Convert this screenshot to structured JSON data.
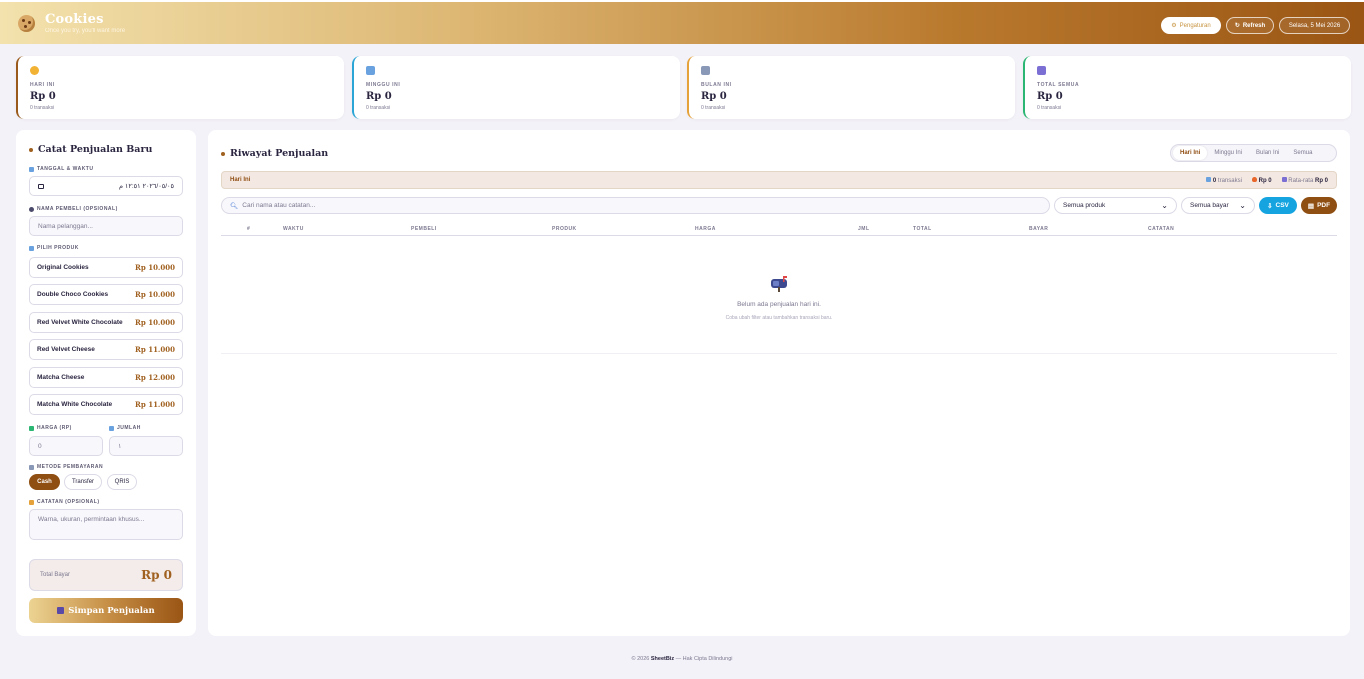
{
  "header": {
    "brand": "Cookies",
    "tagline": "Once you try, you'll want more",
    "settings_label": "Pengaturan",
    "refresh_label": "Refresh",
    "date_label": "Selasa, 5 Mei 2026"
  },
  "stats": [
    {
      "label": "HARI INI",
      "value": "Rp 0",
      "sub": "0 transaksi",
      "accent": "#9a5a1c"
    },
    {
      "label": "MINGGU INI",
      "value": "Rp 0",
      "sub": "0 transaksi",
      "accent": "#2aa5d6"
    },
    {
      "label": "BULAN INI",
      "value": "Rp 0",
      "sub": "0 transaksi",
      "accent": "#e6a23a"
    },
    {
      "label": "TOTAL SEMUA",
      "value": "Rp 0",
      "sub": "0 transaksi",
      "accent": "#2bb673"
    }
  ],
  "form": {
    "title": "Catat Penjualan Baru",
    "datetime_label": "TANGGAL & WAKTU",
    "datetime_value": "٢٠٢٦/٠٥/٠٥ ١٢:٥١ م",
    "buyer_label": "NAMA PEMBELI (OPSIONAL)",
    "buyer_placeholder": "Nama pelanggan...",
    "product_label": "PILIH PRODUK",
    "products": [
      {
        "name": "Original Cookies",
        "price": "Rp 10.000"
      },
      {
        "name": "Double Choco Cookies",
        "price": "Rp 10.000"
      },
      {
        "name": "Red Velvet White Chocolate",
        "price": "Rp 10.000"
      },
      {
        "name": "Red Velvet Cheese",
        "price": "Rp 11.000"
      },
      {
        "name": "Matcha Cheese",
        "price": "Rp 12.000"
      },
      {
        "name": "Matcha White Chocolate",
        "price": "Rp 11.000"
      }
    ],
    "price_label": "HARGA (RP)",
    "price_value": "0",
    "qty_label": "JUMLAH",
    "qty_value": "١",
    "payment_label": "METODE PEMBAYARAN",
    "payments": [
      "Cash",
      "Transfer",
      "QRIS"
    ],
    "payment_selected": "Cash",
    "notes_label": "CATATAN (OPSIONAL)",
    "notes_placeholder": "Warna, ukuran, permintaan khusus...",
    "total_label": "Total Bayar",
    "total_value": "Rp 0",
    "save_label": "Simpan Penjualan"
  },
  "history": {
    "title": "Riwayat Penjualan",
    "tabs": [
      "Hari Ini",
      "Minggu Ini",
      "Bulan Ini",
      "Semua"
    ],
    "active_tab": "Hari Ini",
    "summary_label": "Hari Ini",
    "summary_count_value": "0",
    "summary_count_unit": "transaksi",
    "summary_total": "Rp 0",
    "summary_avg_label": "Rata-rata",
    "summary_avg_value": "Rp 0",
    "search_placeholder": "Cari nama atau catatan...",
    "product_filter": "Semua produk",
    "payment_filter": "Semua bayar",
    "csv_label": "CSV",
    "pdf_label": "PDF",
    "columns": [
      "#",
      "WAKTU",
      "PEMBELI",
      "PRODUK",
      "HARGA",
      "JML",
      "TOTAL",
      "BAYAR",
      "CATATAN"
    ],
    "empty_title": "Belum ada penjualan hari ini.",
    "empty_hint": "Coba ubah filter atau tambahkan transaksi baru."
  },
  "footer": {
    "prefix": "© 2026 ",
    "brand": "SheetBiz",
    "suffix": " — Hak Cipta Dilindungi"
  }
}
